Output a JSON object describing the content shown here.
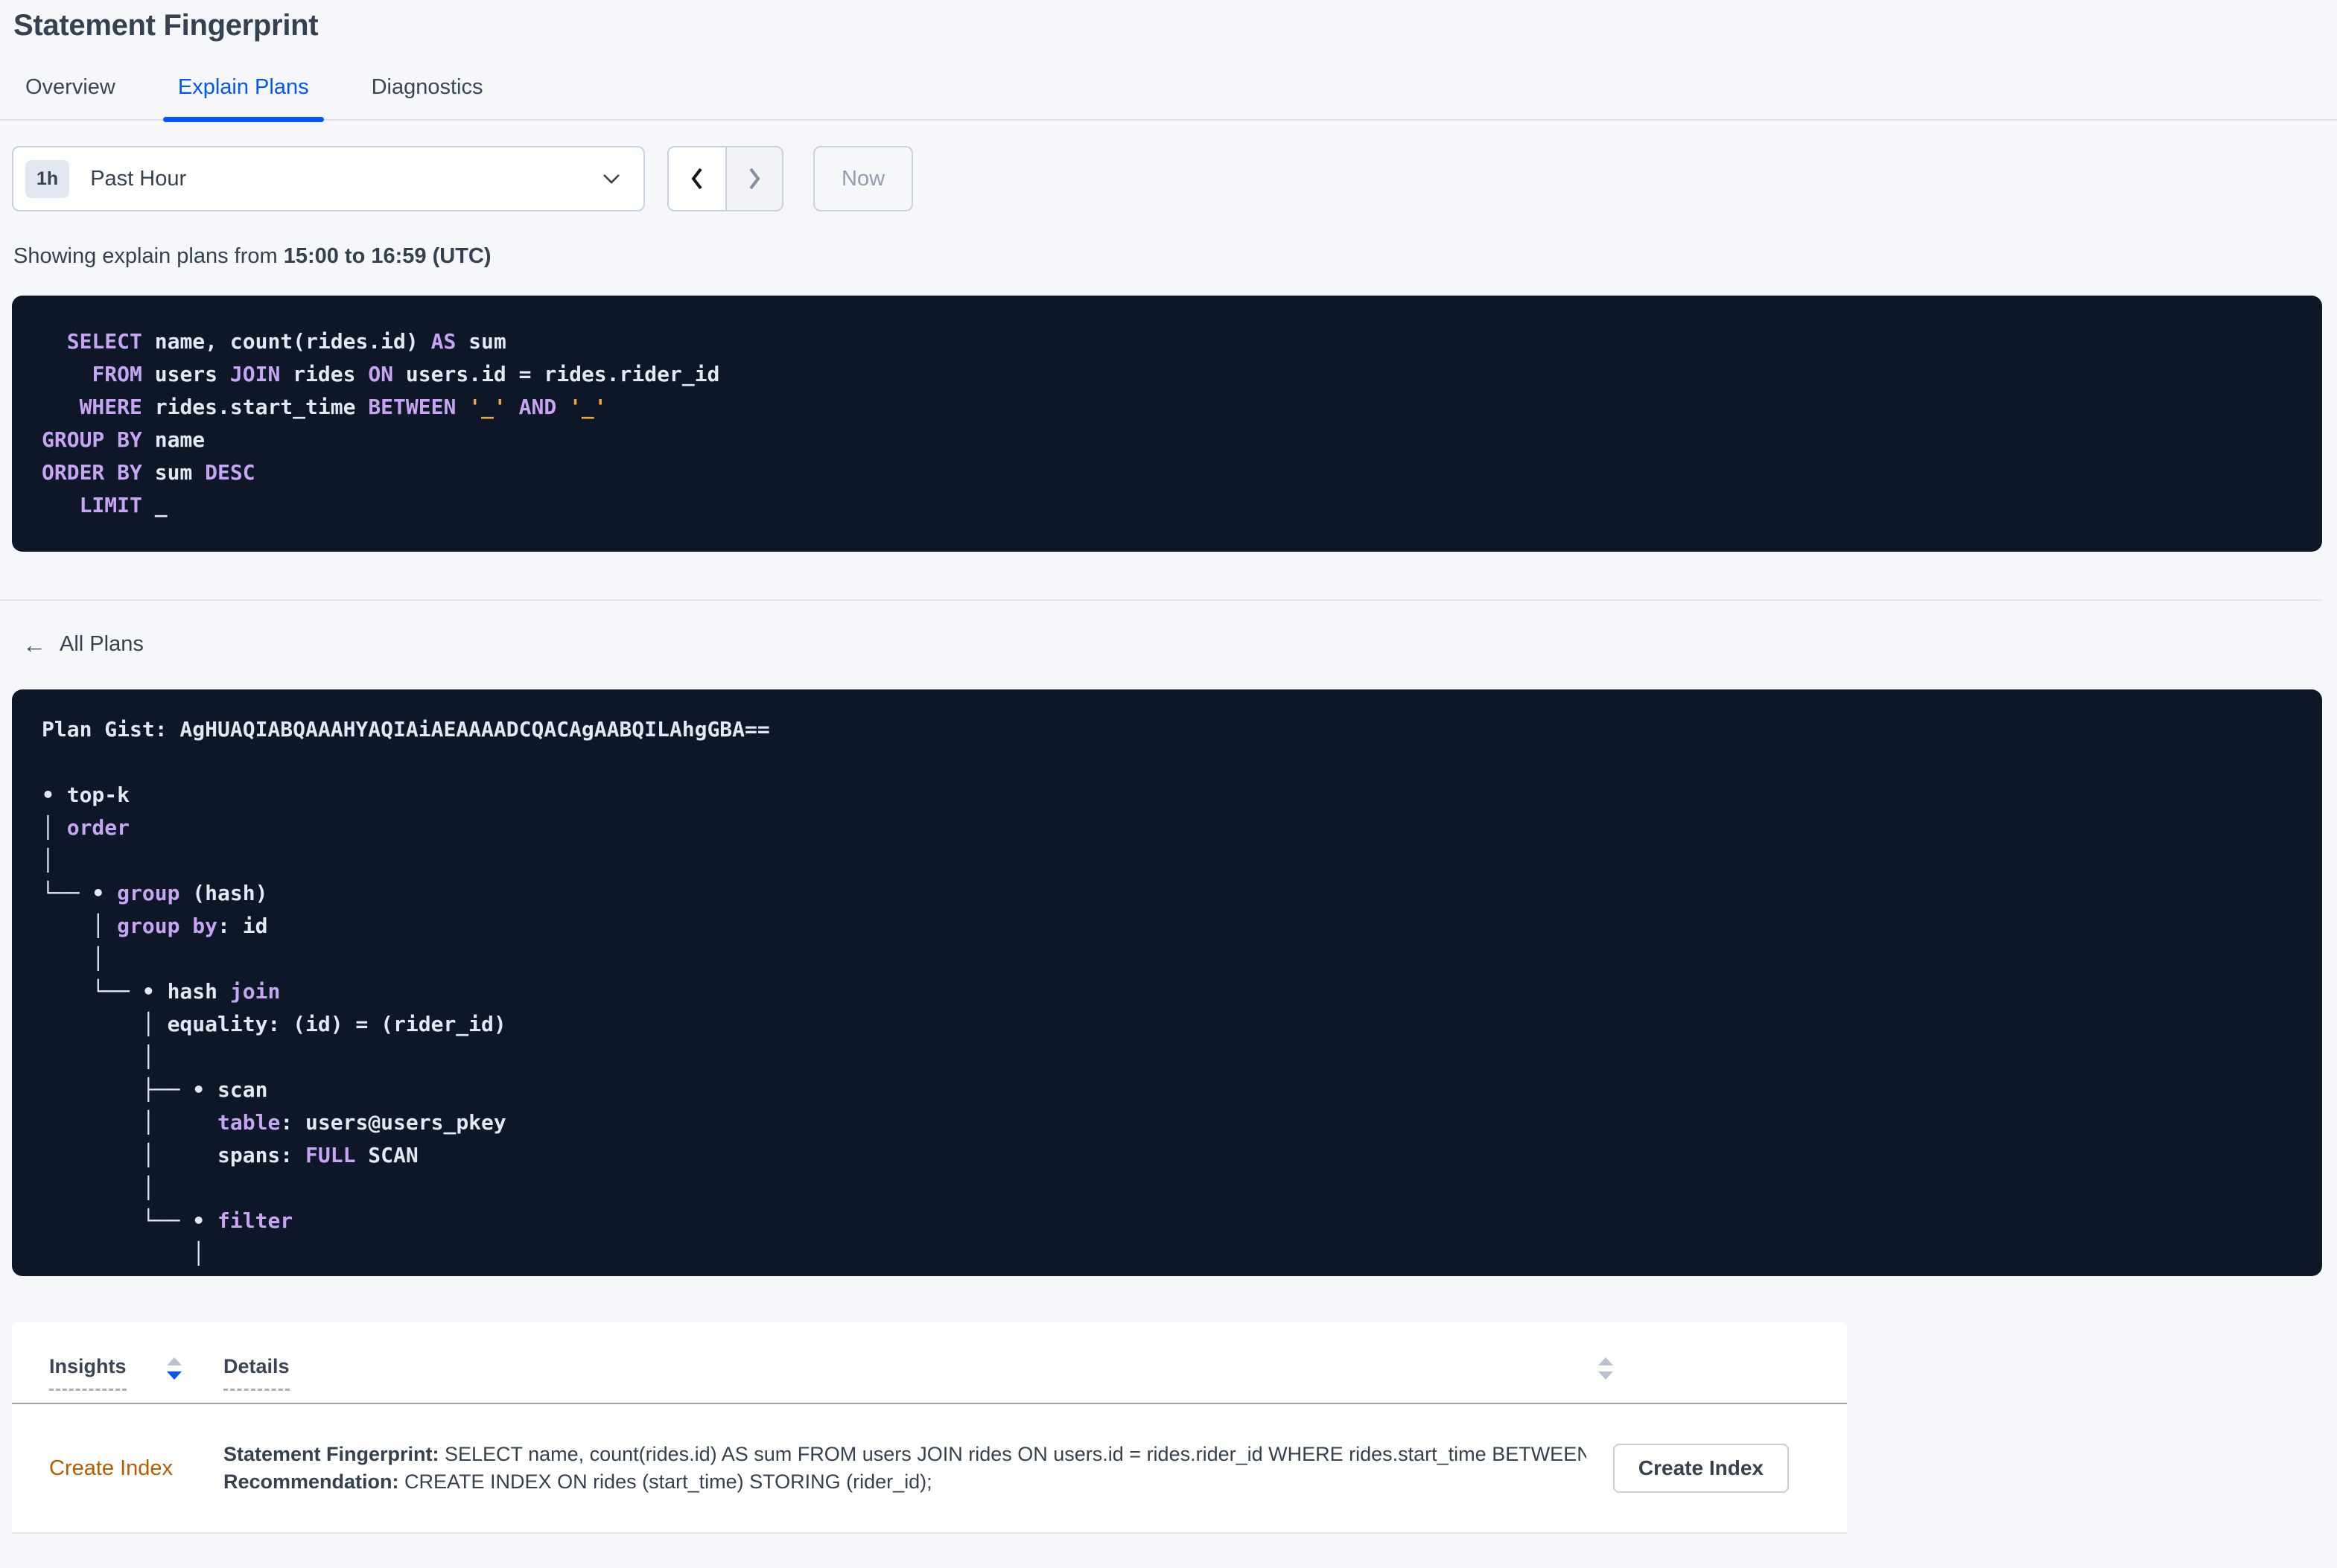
{
  "page": {
    "title": "Statement Fingerprint"
  },
  "tabs": [
    {
      "label": "Overview",
      "active": false
    },
    {
      "label": "Explain Plans",
      "active": true
    },
    {
      "label": "Diagnostics",
      "active": false
    }
  ],
  "toolbar": {
    "range_badge": "1h",
    "range_label": "Past Hour",
    "now_label": "Now"
  },
  "showing": {
    "prefix": "Showing explain plans from ",
    "range": "15:00 to 16:59 (UTC)"
  },
  "sql_block": {
    "lines": [
      [
        [
          "",
          "  "
        ],
        [
          "kw",
          "SELECT"
        ],
        [
          "",
          " name, count(rides.id) "
        ],
        [
          "kw",
          "AS"
        ],
        [
          "",
          " sum"
        ]
      ],
      [
        [
          "",
          "    "
        ],
        [
          "kw",
          "FROM"
        ],
        [
          "",
          " users "
        ],
        [
          "kw",
          "JOIN"
        ],
        [
          "",
          " rides "
        ],
        [
          "kw",
          "ON"
        ],
        [
          "",
          " users.id = rides.rider_id"
        ]
      ],
      [
        [
          "",
          "   "
        ],
        [
          "kw",
          "WHERE"
        ],
        [
          "",
          " rides.start_time "
        ],
        [
          "kw",
          "BETWEEN"
        ],
        [
          "",
          " "
        ],
        [
          "lit",
          "'_'"
        ],
        [
          "",
          " "
        ],
        [
          "kw",
          "AND"
        ],
        [
          "",
          " "
        ],
        [
          "lit",
          "'_'"
        ]
      ],
      [
        [
          "kw",
          "GROUP BY"
        ],
        [
          "",
          " name"
        ]
      ],
      [
        [
          "kw",
          "ORDER BY"
        ],
        [
          "",
          " sum "
        ],
        [
          "kw",
          "DESC"
        ]
      ],
      [
        [
          "",
          "   "
        ],
        [
          "kw",
          "LIMIT"
        ],
        [
          "",
          " _"
        ]
      ]
    ]
  },
  "all_plans": {
    "label": "All Plans",
    "back_arrow_glyph": "←"
  },
  "plan_block": {
    "lines": [
      [
        [
          "",
          "Plan Gist: AgHUAQIABQAAAHYAQIAiAEAAAADCQACAgAABQILAhgGBA=="
        ]
      ],
      [
        [
          "",
          ""
        ]
      ],
      [
        [
          "",
          "• top-k"
        ]
      ],
      [
        [
          "",
          "│ "
        ],
        [
          "kw",
          "order"
        ]
      ],
      [
        [
          "",
          "│"
        ]
      ],
      [
        [
          "",
          "└── • "
        ],
        [
          "kw",
          "group"
        ],
        [
          "",
          " (hash)"
        ]
      ],
      [
        [
          "",
          "    │ "
        ],
        [
          "kw",
          "group by"
        ],
        [
          "",
          ": id"
        ]
      ],
      [
        [
          "",
          "    │"
        ]
      ],
      [
        [
          "",
          "    └── • hash "
        ],
        [
          "kw",
          "join"
        ]
      ],
      [
        [
          "",
          "        │ equality: (id) = (rider_id)"
        ]
      ],
      [
        [
          "",
          "        │"
        ]
      ],
      [
        [
          "",
          "        ├── • scan"
        ]
      ],
      [
        [
          "",
          "        │     "
        ],
        [
          "kw",
          "table"
        ],
        [
          "",
          ": users@users_pkey"
        ]
      ],
      [
        [
          "",
          "        │     spans: "
        ],
        [
          "kw",
          "FULL"
        ],
        [
          "",
          " SCAN"
        ]
      ],
      [
        [
          "",
          "        │"
        ]
      ],
      [
        [
          "",
          "        └── • "
        ],
        [
          "kw",
          "filter"
        ]
      ],
      [
        [
          "",
          "            │"
        ]
      ]
    ]
  },
  "insights_table": {
    "columns": [
      {
        "label": "Insights"
      },
      {
        "label": "Details"
      }
    ],
    "rows": [
      {
        "insight": "Create Index",
        "details": [
          {
            "label": "Statement Fingerprint:",
            "text": " SELECT name, count(rides.id) AS sum FROM users JOIN rides ON users.id = rides.rider_id WHERE rides.start_time BETWEEN '_…"
          },
          {
            "label": "Recommendation:",
            "text": " CREATE INDEX ON rides (start_time) STORING (rider_id);"
          }
        ],
        "action": "Create Index"
      }
    ]
  },
  "colors": {
    "accent_blue": "#0156FF",
    "code_background": "#0D1727",
    "keyword_purple": "#C7A5F2",
    "literal_orange": "#EFA43F",
    "insight_orange": "#B85C00",
    "page_background": "#F5F7FA"
  }
}
